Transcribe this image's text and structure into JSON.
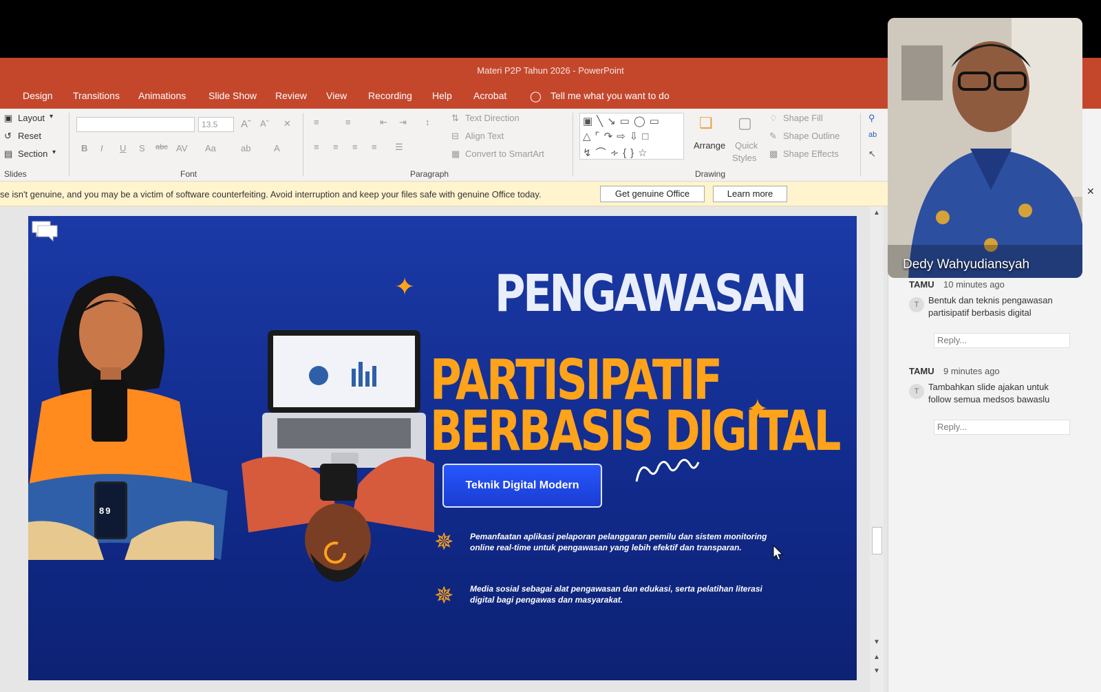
{
  "window": {
    "title": "Materi P2P Tahun 2026  -  PowerPoint"
  },
  "tabs": [
    "Design",
    "Transitions",
    "Animations",
    "Slide Show",
    "Review",
    "View",
    "Recording",
    "Help",
    "Acrobat"
  ],
  "tell_me": "Tell me what you want to do",
  "ribbon": {
    "slides": {
      "layout": "Layout",
      "reset": "Reset",
      "section": "Section",
      "label": "Slides"
    },
    "font": {
      "size": "13.5",
      "label": "Font"
    },
    "paragraph": {
      "text_direction": "Text Direction",
      "align_text": "Align Text",
      "convert_smartart": "Convert to SmartArt",
      "label": "Paragraph"
    },
    "drawing": {
      "arrange": "Arrange",
      "quick_styles_1": "Quick",
      "quick_styles_2": "Styles",
      "shape_fill": "Shape Fill",
      "shape_outline": "Shape Outline",
      "shape_effects": "Shape Effects",
      "label": "Drawing"
    }
  },
  "notice": {
    "text": "se isn't genuine, and you may be a victim of software counterfeiting. Avoid interruption and keep your files safe with genuine Office today.",
    "btn_genuine": "Get genuine Office",
    "btn_learn": "Learn more"
  },
  "slide": {
    "title_1": "PENGAWASAN",
    "title_2": "PARTISIPATIF",
    "title_3": "BERBASIS DIGITAL",
    "pill": "Teknik Digital Modern",
    "bullet_1": "Pemanfaatan aplikasi pelaporan pelanggaran pemilu dan sistem monitoring online real-time untuk pengawasan yang lebih efektif dan transparan.",
    "bullet_2": "Media sosial sebagai alat pengawasan dan edukasi, serta pelatihan literasi digital bagi pengawas dan masyarakat.",
    "phone_digits": "89"
  },
  "video": {
    "name": "Dedy Wahyudiansyah"
  },
  "comments": [
    {
      "author": "TAMU",
      "time": "10 minutes ago",
      "avatar": "T",
      "text": "Bentuk dan teknis pengawasan partisipatif berbasis digital",
      "reply": "Reply..."
    },
    {
      "author": "TAMU",
      "time": "9 minutes ago",
      "avatar": "T",
      "text": "Tambahkan slide ajakan untuk follow semua medsos bawaslu",
      "reply": "Reply..."
    }
  ],
  "colors": {
    "accent": "#c4472c",
    "slide_bg": "#1b3aa6",
    "orange": "#ffa31a"
  }
}
